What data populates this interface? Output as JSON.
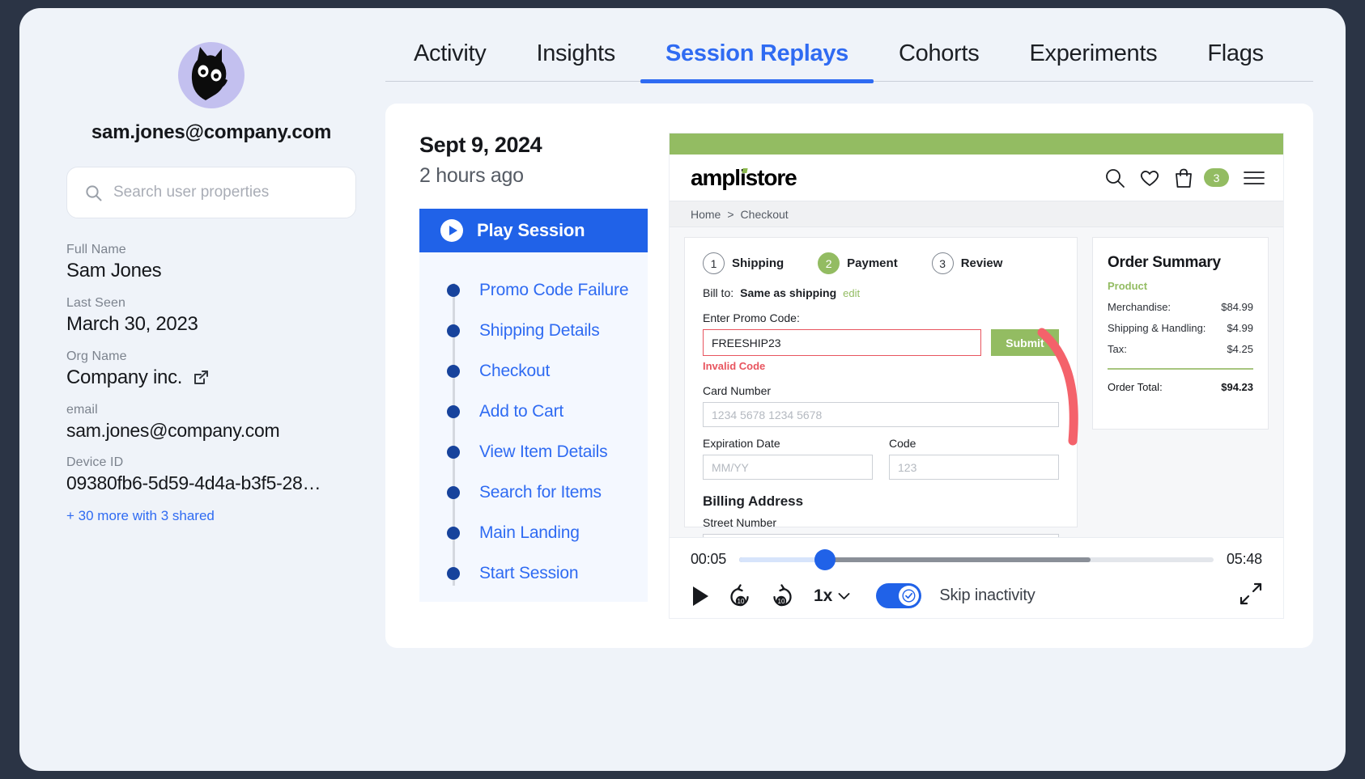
{
  "sidebar": {
    "avatar_icon": "cat-mascot-avatar",
    "avatar_bg": "#c3c0ef",
    "user_email": "sam.jones@company.com",
    "search": {
      "icon": "search-icon",
      "placeholder": "Search user properties",
      "value": ""
    },
    "properties": [
      {
        "label": "Full Name",
        "value": "Sam Jones"
      },
      {
        "label": "Last Seen",
        "value": "March 30, 2023"
      },
      {
        "label": "Org Name",
        "value": "Company inc.",
        "icon": "external-link-icon"
      },
      {
        "label": "email",
        "value": "sam.jones@company.com"
      },
      {
        "label": "Device ID",
        "value": "09380fb6-5d59-4d4a-b3f5-28…"
      }
    ],
    "more_link": "+ 30 more with 3 shared"
  },
  "tabs": [
    {
      "label": "Activity",
      "active": false
    },
    {
      "label": "Insights",
      "active": false
    },
    {
      "label": "Session Replays",
      "active": true
    },
    {
      "label": "Cohorts",
      "active": false
    },
    {
      "label": "Experiments",
      "active": false
    },
    {
      "label": "Flags",
      "active": false
    }
  ],
  "accent_color": "#2f6bf2",
  "replay": {
    "session_date": "Sept 9, 2024",
    "session_ago": "2 hours ago",
    "play_session_label": "Play Session",
    "play_icon": "play-circle-icon",
    "steps": [
      "Promo Code Failure",
      "Shipping Details",
      "Checkout",
      "Add to Cart",
      "View Item Details",
      "Search for Items",
      "Main Landing",
      "Start Session"
    ]
  },
  "preview": {
    "brand_green": "#93bc62",
    "store_logo": "amplistore",
    "header_icons": [
      "search-icon",
      "heart-icon",
      "shopping-bag-icon",
      "hamburger-menu-icon"
    ],
    "cart_count": "3",
    "breadcrumb": {
      "home": "Home",
      "separator": ">",
      "current": "Checkout"
    },
    "checkout": {
      "steps": [
        {
          "num": "1",
          "label": "Shipping",
          "active": false
        },
        {
          "num": "2",
          "label": "Payment",
          "active": true
        },
        {
          "num": "3",
          "label": "Review",
          "active": false
        }
      ],
      "bill_to_label": "Bill to:",
      "bill_to_value": "Same as shipping",
      "bill_to_edit": "edit",
      "promo_label": "Enter Promo Code:",
      "promo_value": "FREESHIP23",
      "promo_submit": "Submit",
      "promo_error": "Invalid Code",
      "card_number_label": "Card Number",
      "card_number_placeholder": "1234 5678 1234 5678",
      "expiration_label": "Expiration Date",
      "expiration_placeholder": "MM/YY",
      "code_label": "Code",
      "code_placeholder": "123",
      "billing_address_title": "Billing Address",
      "street_number_label": "Street Number",
      "street_number_placeholder": ""
    },
    "order_summary": {
      "title": "Order Summary",
      "product_header": "Product",
      "rows": [
        {
          "label": "Merchandise:",
          "value": "$84.99"
        },
        {
          "label": "Shipping & Handling:",
          "value": "$4.99"
        },
        {
          "label": "Tax:",
          "value": "$4.25"
        }
      ],
      "total_label": "Order Total:",
      "total_value": "$94.23"
    },
    "annotation_arrow_color": "#f4626b"
  },
  "controls": {
    "current_time": "00:05",
    "total_time": "05:48",
    "progress_percent": 18,
    "buffered_percent": 74,
    "play_icon": "play-icon",
    "rewind_icon": "rewind-10-icon",
    "forward_icon": "forward-10-icon",
    "speed": "1x",
    "speed_chevron": "chevron-down-icon",
    "skip_inactivity_label": "Skip inactivity",
    "skip_inactivity_on": true,
    "fullscreen_icon": "expand-icon"
  }
}
